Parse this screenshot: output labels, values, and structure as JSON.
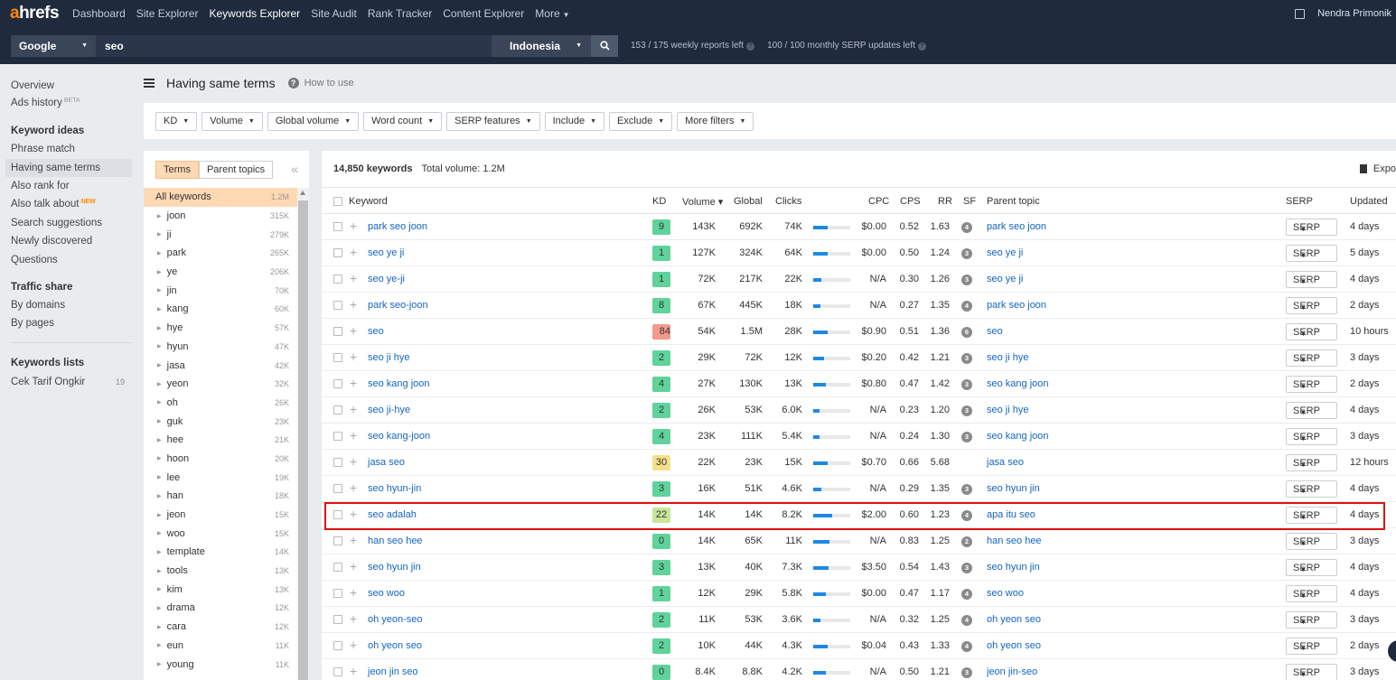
{
  "topnav": {
    "logo_a": "a",
    "logo_rest": "hrefs",
    "items": [
      "Dashboard",
      "Site Explorer",
      "Keywords Explorer",
      "Site Audit",
      "Rank Tracker",
      "Content Explorer"
    ],
    "more": "More",
    "user": "Nendra Primonik"
  },
  "search": {
    "engine": "Google",
    "query": "seo",
    "country": "Indonesia",
    "weekly": "153 / 175 weekly reports left",
    "monthly": "100 / 100 monthly SERP updates left"
  },
  "leftnav": {
    "overview": "Overview",
    "ads_history": "Ads history",
    "beta": "BETA",
    "ideas_head": "Keyword ideas",
    "phrase": "Phrase match",
    "same_terms": "Having same terms",
    "also_rank": "Also rank for",
    "also_talk": "Also talk about",
    "new": "NEW",
    "suggestions": "Search suggestions",
    "newly": "Newly discovered",
    "questions": "Questions",
    "traffic_head": "Traffic share",
    "by_domains": "By domains",
    "by_pages": "By pages",
    "lists_head": "Keywords lists",
    "list_name": "Cek Tarif Ongkir",
    "list_count": "19"
  },
  "page": {
    "title": "Having same terms",
    "howto": "How to use"
  },
  "filters": [
    "KD",
    "Volume",
    "Global volume",
    "Word count",
    "SERP features",
    "Include",
    "Exclude",
    "More filters"
  ],
  "terms_panel": {
    "tab_terms": "Terms",
    "tab_parent": "Parent topics",
    "items": [
      {
        "label": "All keywords",
        "count": "1.2M"
      },
      {
        "label": "joon",
        "count": "315K"
      },
      {
        "label": "ji",
        "count": "279K"
      },
      {
        "label": "park",
        "count": "265K"
      },
      {
        "label": "ye",
        "count": "206K"
      },
      {
        "label": "jin",
        "count": "70K"
      },
      {
        "label": "kang",
        "count": "60K"
      },
      {
        "label": "hye",
        "count": "57K"
      },
      {
        "label": "hyun",
        "count": "47K"
      },
      {
        "label": "jasa",
        "count": "42K"
      },
      {
        "label": "yeon",
        "count": "32K"
      },
      {
        "label": "oh",
        "count": "26K"
      },
      {
        "label": "guk",
        "count": "23K"
      },
      {
        "label": "hee",
        "count": "21K"
      },
      {
        "label": "hoon",
        "count": "20K"
      },
      {
        "label": "lee",
        "count": "19K"
      },
      {
        "label": "han",
        "count": "18K"
      },
      {
        "label": "jeon",
        "count": "15K"
      },
      {
        "label": "woo",
        "count": "15K"
      },
      {
        "label": "template",
        "count": "14K"
      },
      {
        "label": "tools",
        "count": "13K"
      },
      {
        "label": "kim",
        "count": "13K"
      },
      {
        "label": "drama",
        "count": "12K"
      },
      {
        "label": "cara",
        "count": "12K"
      },
      {
        "label": "eun",
        "count": "11K"
      },
      {
        "label": "young",
        "count": "11K"
      }
    ]
  },
  "table": {
    "summary_count": "14,850 keywords",
    "summary_volume": "Total volume: 1.2M",
    "export": "Expo",
    "headers": {
      "keyword": "Keyword",
      "kd": "KD",
      "volume": "Volume ▾",
      "global": "Global",
      "clicks": "Clicks",
      "cpc": "CPC",
      "cps": "CPS",
      "rr": "RR",
      "sf": "SF",
      "parent": "Parent topic",
      "serp": "SERP",
      "updated": "Updated"
    },
    "serp_label": "SERP",
    "rows": [
      {
        "kw": "park seo joon",
        "kd": "9",
        "kdc": "g",
        "vol": "143K",
        "glob": "692K",
        "clicks": "74K",
        "bar": 0.4,
        "cpc": "$0.00",
        "cps": "0.52",
        "rr": "1.63",
        "sf": "4",
        "parent": "park seo joon",
        "upd": "4 days"
      },
      {
        "kw": "seo ye ji",
        "kd": "1",
        "kdc": "g",
        "vol": "127K",
        "glob": "324K",
        "clicks": "64K",
        "bar": 0.4,
        "cpc": "$0.00",
        "cps": "0.50",
        "rr": "1.24",
        "sf": "3",
        "parent": "seo ye ji",
        "upd": "5 days"
      },
      {
        "kw": "seo ye-ji",
        "kd": "1",
        "kdc": "g",
        "vol": "72K",
        "glob": "217K",
        "clicks": "22K",
        "bar": 0.22,
        "cpc": "N/A",
        "cps": "0.30",
        "rr": "1.26",
        "sf": "3",
        "parent": "seo ye ji",
        "upd": "4 days"
      },
      {
        "kw": "park seo-joon",
        "kd": "8",
        "kdc": "g",
        "vol": "67K",
        "glob": "445K",
        "clicks": "18K",
        "bar": 0.2,
        "cpc": "N/A",
        "cps": "0.27",
        "rr": "1.35",
        "sf": "4",
        "parent": "park seo joon",
        "upd": "2 days"
      },
      {
        "kw": "seo",
        "kd": "84",
        "kdc": "r",
        "vol": "54K",
        "glob": "1.5M",
        "clicks": "28K",
        "bar": 0.38,
        "cpc": "$0.90",
        "cps": "0.51",
        "rr": "1.36",
        "sf": "6",
        "parent": "seo",
        "upd": "10 hours"
      },
      {
        "kw": "seo ji hye",
        "kd": "2",
        "kdc": "g",
        "vol": "29K",
        "glob": "72K",
        "clicks": "12K",
        "bar": 0.3,
        "cpc": "$0.20",
        "cps": "0.42",
        "rr": "1.21",
        "sf": "3",
        "parent": "seo ji hye",
        "upd": "3 days"
      },
      {
        "kw": "seo kang joon",
        "kd": "4",
        "kdc": "g",
        "vol": "27K",
        "glob": "130K",
        "clicks": "13K",
        "bar": 0.35,
        "cpc": "$0.80",
        "cps": "0.47",
        "rr": "1.42",
        "sf": "3",
        "parent": "seo kang joon",
        "upd": "2 days"
      },
      {
        "kw": "seo ji-hye",
        "kd": "2",
        "kdc": "g",
        "vol": "26K",
        "glob": "53K",
        "clicks": "6.0K",
        "bar": 0.18,
        "cpc": "N/A",
        "cps": "0.23",
        "rr": "1.20",
        "sf": "3",
        "parent": "seo ji hye",
        "upd": "4 days"
      },
      {
        "kw": "seo kang-joon",
        "kd": "4",
        "kdc": "g",
        "vol": "23K",
        "glob": "111K",
        "clicks": "5.4K",
        "bar": 0.18,
        "cpc": "N/A",
        "cps": "0.24",
        "rr": "1.30",
        "sf": "3",
        "parent": "seo kang joon",
        "upd": "3 days"
      },
      {
        "kw": "jasa seo",
        "kd": "30",
        "kdc": "y",
        "vol": "22K",
        "glob": "23K",
        "clicks": "15K",
        "bar": 0.38,
        "cpc": "$0.70",
        "cps": "0.66",
        "rr": "5.68",
        "sf": "",
        "parent": "jasa seo",
        "upd": "12 hours"
      },
      {
        "kw": "seo hyun-jin",
        "kd": "3",
        "kdc": "g",
        "vol": "16K",
        "glob": "51K",
        "clicks": "4.6K",
        "bar": 0.22,
        "cpc": "N/A",
        "cps": "0.29",
        "rr": "1.35",
        "sf": "3",
        "parent": "seo hyun jin",
        "upd": "4 days"
      },
      {
        "kw": "seo adalah",
        "kd": "22",
        "kdc": "lg",
        "vol": "14K",
        "glob": "14K",
        "clicks": "8.2K",
        "bar": 0.52,
        "cpc": "$2.00",
        "cps": "0.60",
        "rr": "1.23",
        "sf": "4",
        "parent": "apa itu seo",
        "upd": "4 days"
      },
      {
        "kw": "han seo hee",
        "kd": "0",
        "kdc": "g",
        "vol": "14K",
        "glob": "65K",
        "clicks": "11K",
        "bar": 0.45,
        "cpc": "N/A",
        "cps": "0.83",
        "rr": "1.25",
        "sf": "2",
        "parent": "han seo hee",
        "upd": "3 days"
      },
      {
        "kw": "seo hyun jin",
        "kd": "3",
        "kdc": "g",
        "vol": "13K",
        "glob": "40K",
        "clicks": "7.3K",
        "bar": 0.42,
        "cpc": "$3.50",
        "cps": "0.54",
        "rr": "1.43",
        "sf": "3",
        "parent": "seo hyun jin",
        "upd": "4 days"
      },
      {
        "kw": "seo woo",
        "kd": "1",
        "kdc": "g",
        "vol": "12K",
        "glob": "29K",
        "clicks": "5.8K",
        "bar": 0.35,
        "cpc": "$0.00",
        "cps": "0.47",
        "rr": "1.17",
        "sf": "4",
        "parent": "seo woo",
        "upd": "4 days"
      },
      {
        "kw": "oh yeon-seo",
        "kd": "2",
        "kdc": "g",
        "vol": "11K",
        "glob": "53K",
        "clicks": "3.6K",
        "bar": 0.2,
        "cpc": "N/A",
        "cps": "0.32",
        "rr": "1.25",
        "sf": "4",
        "parent": "oh yeon seo",
        "upd": "3 days"
      },
      {
        "kw": "oh yeon seo",
        "kd": "2",
        "kdc": "g",
        "vol": "10K",
        "glob": "44K",
        "clicks": "4.3K",
        "bar": 0.4,
        "cpc": "$0.04",
        "cps": "0.43",
        "rr": "1.33",
        "sf": "4",
        "parent": "oh yeon seo",
        "upd": "2 days"
      },
      {
        "kw": "jeon jin seo",
        "kd": "0",
        "kdc": "g",
        "vol": "8.4K",
        "glob": "8.8K",
        "clicks": "4.2K",
        "bar": 0.35,
        "cpc": "N/A",
        "cps": "0.50",
        "rr": "1.21",
        "sf": "3",
        "parent": "jeon jin-seo",
        "upd": "3 days"
      }
    ]
  },
  "colors": {
    "nav_bg": "#1f2a3d",
    "accent": "#ff8800",
    "link": "#1565c0",
    "highlight": "#e01010"
  }
}
